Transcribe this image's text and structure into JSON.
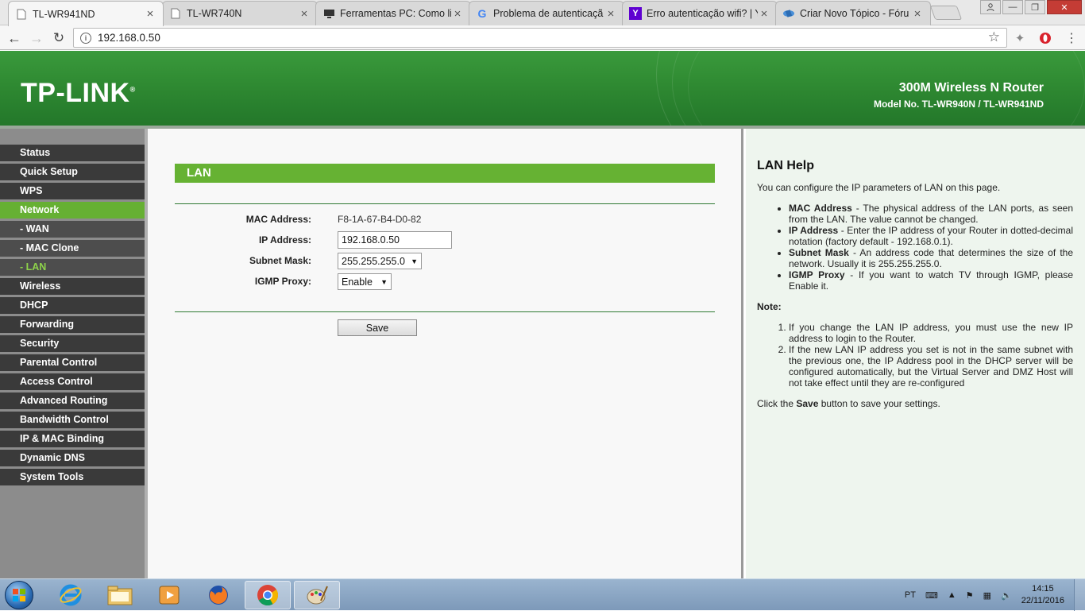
{
  "browser": {
    "tabs": [
      {
        "title": "TL-WR941ND",
        "icon": "page-icon",
        "active": true
      },
      {
        "title": "TL-WR740N",
        "icon": "page-icon",
        "active": false
      },
      {
        "title": "Ferramentas PC: Como li",
        "icon": "monitor-icon",
        "active": false
      },
      {
        "title": "Problema de autenticaçã",
        "icon": "google-icon",
        "active": false
      },
      {
        "title": "Erro autenticação wifi? | Y",
        "icon": "yahoo-icon",
        "active": false
      },
      {
        "title": "Criar Novo Tópico - Fóru",
        "icon": "forum-icon",
        "active": false
      }
    ],
    "address": "192.168.0.50"
  },
  "header": {
    "logo": "TP-LINK",
    "product": "300M Wireless N Router",
    "model": "Model No. TL-WR940N / TL-WR941ND"
  },
  "sidebar": {
    "items": [
      {
        "label": "Status",
        "type": "main"
      },
      {
        "label": "Quick Setup",
        "type": "main"
      },
      {
        "label": "WPS",
        "type": "main"
      },
      {
        "label": "Network",
        "type": "active"
      },
      {
        "label": "- WAN",
        "type": "sub"
      },
      {
        "label": "- MAC Clone",
        "type": "sub"
      },
      {
        "label": "- LAN",
        "type": "current"
      },
      {
        "label": "Wireless",
        "type": "main"
      },
      {
        "label": "DHCP",
        "type": "main"
      },
      {
        "label": "Forwarding",
        "type": "main"
      },
      {
        "label": "Security",
        "type": "main"
      },
      {
        "label": "Parental Control",
        "type": "main"
      },
      {
        "label": "Access Control",
        "type": "main"
      },
      {
        "label": "Advanced Routing",
        "type": "main"
      },
      {
        "label": "Bandwidth Control",
        "type": "main"
      },
      {
        "label": "IP & MAC Binding",
        "type": "main"
      },
      {
        "label": "Dynamic DNS",
        "type": "main"
      },
      {
        "label": "System Tools",
        "type": "main"
      }
    ]
  },
  "main": {
    "section_title": "LAN",
    "mac_label": "MAC Address:",
    "mac_value": "F8-1A-67-B4-D0-82",
    "ip_label": "IP Address:",
    "ip_value": "192.168.0.50",
    "subnet_label": "Subnet Mask:",
    "subnet_value": "255.255.255.0",
    "igmp_label": "IGMP Proxy:",
    "igmp_value": "Enable",
    "save_label": "Save"
  },
  "help": {
    "title": "LAN Help",
    "intro": "You can configure the IP parameters of LAN on this page.",
    "bullets": [
      {
        "term": "MAC Address",
        "text": " - The physical address of the LAN ports, as seen from the LAN. The value cannot be changed."
      },
      {
        "term": "IP Address",
        "text": " - Enter the IP address of your Router in dotted-decimal notation (factory default - 192.168.0.1)."
      },
      {
        "term": "Subnet Mask",
        "text": " - An address code that determines the size of the network. Usually it is 255.255.255.0."
      },
      {
        "term": "IGMP Proxy",
        "text": " - If you want to watch TV through IGMP, please Enable it."
      }
    ],
    "note_label": "Note:",
    "notes": [
      "If you change the LAN IP address, you must use the new IP address to login to the Router.",
      "If the new LAN IP address you set is not in the same subnet with the previous one, the IP Address pool in the DHCP server will be configured automatically, but the Virtual Server and DMZ Host will not take effect until they are re-configured"
    ],
    "closing_pre": "Click the ",
    "closing_bold": "Save",
    "closing_post": " button to save your settings."
  },
  "taskbar": {
    "language": "PT",
    "time": "14:15",
    "date": "22/11/2016"
  }
}
